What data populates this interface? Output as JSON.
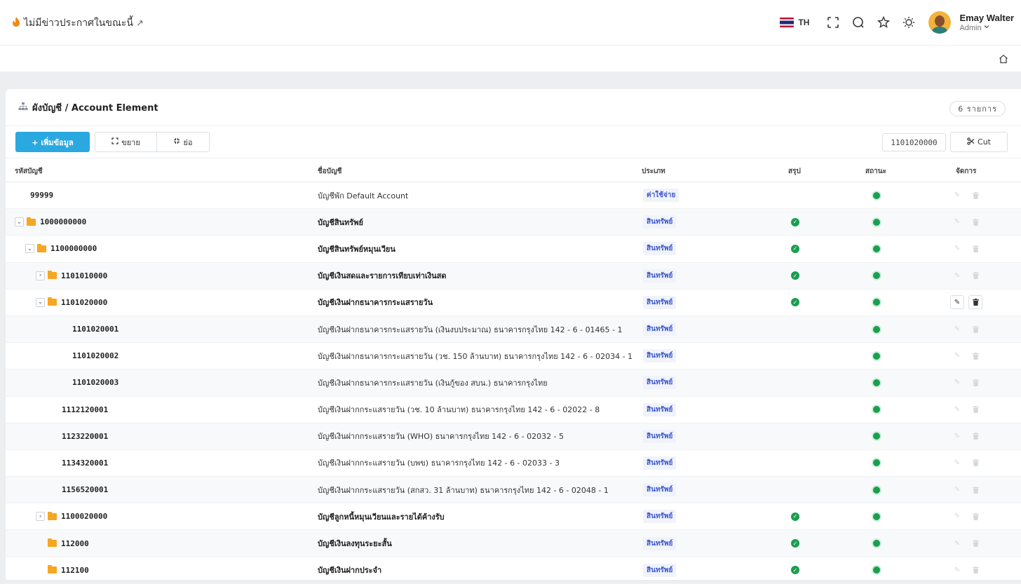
{
  "header": {
    "announcement": "ไม่มีข่าวประกาศในขณะนี้",
    "language": "TH",
    "user_name": "Emay Walter",
    "user_role": "Admin"
  },
  "card": {
    "title": "ผังบัญชี / Account Element",
    "count_badge": "6 รายการ"
  },
  "toolbar": {
    "add_label": "+ เพิ่มข้อมูล",
    "expand_label": "ขยาย",
    "collapse_label": "ย่อ",
    "selected_code": "1101020000",
    "cut_label": "Cut"
  },
  "columns": [
    "รหัสบัญชี",
    "ชื่อบัญชี",
    "ประเภท",
    "สรุป",
    "สถานะ",
    "จัดการ"
  ],
  "rows": [
    {
      "code": "99999",
      "name": "บัญชีพัก Default Account",
      "type": "ค่าใช้จ่าย",
      "summary": false,
      "level": 0,
      "folder": false,
      "toggle": "",
      "bold": false,
      "active": false
    },
    {
      "code": "1000000000",
      "name": "บัญชีสินทรัพย์",
      "type": "สินทรัพย์",
      "summary": true,
      "level": 0,
      "folder": true,
      "toggle": "expanded",
      "bold": true,
      "active": false
    },
    {
      "code": "1100000000",
      "name": "บัญชีสินทรัพย์หมุนเวียน",
      "type": "สินทรัพย์",
      "summary": true,
      "level": 1,
      "folder": true,
      "toggle": "expanded",
      "bold": true,
      "active": false
    },
    {
      "code": "1101010000",
      "name": "บัญชีเงินสดและรายการเทียบเท่าเงินสด",
      "type": "สินทรัพย์",
      "summary": true,
      "level": 2,
      "folder": true,
      "toggle": "collapsed",
      "bold": true,
      "active": false
    },
    {
      "code": "1101020000",
      "name": "บัญชีเงินฝากธนาคารกระแสรายวัน",
      "type": "สินทรัพย์",
      "summary": true,
      "level": 2,
      "folder": true,
      "toggle": "expanded",
      "bold": true,
      "active": true
    },
    {
      "code": "1101020001",
      "name": "บัญชีเงินฝากธนาคารกระแสรายวัน (เงินงบประมาณ) ธนาคารกรุงไทย 142 - 6 - 01465 - 1",
      "type": "สินทรัพย์",
      "summary": false,
      "level": 4,
      "folder": false,
      "toggle": "",
      "bold": false,
      "active": false
    },
    {
      "code": "1101020002",
      "name": "บัญชีเงินฝากธนาคารกระแสรายวัน (วช. 150 ล้านบาท) ธนาคารกรุงไทย 142 - 6 - 02034 - 1",
      "type": "สินทรัพย์",
      "summary": false,
      "level": 4,
      "folder": false,
      "toggle": "",
      "bold": false,
      "active": false
    },
    {
      "code": "1101020003",
      "name": "บัญชีเงินฝากธนาคารกระแสรายวัน (เงินกู้ของ สบน.) ธนาคารกรุงไทย",
      "type": "สินทรัพย์",
      "summary": false,
      "level": 4,
      "folder": false,
      "toggle": "",
      "bold": false,
      "active": false
    },
    {
      "code": "1112120001",
      "name": "บัญชีเงินฝากกระแสรายวัน (วช. 10 ล้านบาท) ธนาคารกรุงไทย 142 - 6 - 02022 - 8",
      "type": "สินทรัพย์",
      "summary": false,
      "level": 3,
      "folder": false,
      "toggle": "",
      "bold": false,
      "active": false
    },
    {
      "code": "1123220001",
      "name": "บัญชีเงินฝากกระแสรายวัน (WHO) ธนาคารกรุงไทย 142 - 6 - 02032 - 5",
      "type": "สินทรัพย์",
      "summary": false,
      "level": 3,
      "folder": false,
      "toggle": "",
      "bold": false,
      "active": false
    },
    {
      "code": "1134320001",
      "name": "บัญชีเงินฝากกระแสรายวัน (บพข) ธนาคารกรุงไทย 142 - 6 - 02033 - 3",
      "type": "สินทรัพย์",
      "summary": false,
      "level": 3,
      "folder": false,
      "toggle": "",
      "bold": false,
      "active": false
    },
    {
      "code": "1156520001",
      "name": "บัญชีเงินฝากกระแสรายวัน (สกสว. 31 ล้านบาท) ธนาคารกรุงไทย 142 - 6 - 02048 - 1",
      "type": "สินทรัพย์",
      "summary": false,
      "level": 3,
      "folder": false,
      "toggle": "",
      "bold": false,
      "active": false
    },
    {
      "code": "1100020000",
      "name": "บัญชีลูกหนี้หมุนเวียนและรายได้ค้างรับ",
      "type": "สินทรัพย์",
      "summary": true,
      "level": 2,
      "folder": true,
      "toggle": "collapsed",
      "bold": true,
      "active": false
    },
    {
      "code": "112000",
      "name": "บัญชีเงินลงทุนระยะสั้น",
      "type": "สินทรัพย์",
      "summary": true,
      "level": 2,
      "folder": true,
      "toggle": "none",
      "bold": true,
      "active": false
    },
    {
      "code": "112100",
      "name": "บัญชีเงินฝากประจำ",
      "type": "สินทรัพย์",
      "summary": true,
      "level": 2,
      "folder": true,
      "toggle": "none",
      "bold": true,
      "active": false
    }
  ]
}
